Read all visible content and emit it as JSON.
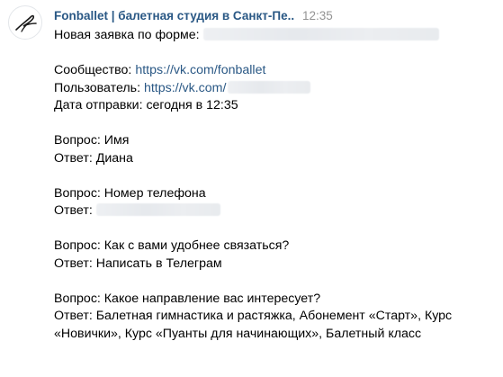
{
  "message": {
    "sender": "Fonballet | балетная студия в Санкт-Пе...",
    "time": "12:35",
    "lines": {
      "form_label": "Новая заявка по форме:",
      "community_label": "Сообщество:",
      "community_link": "https://vk.com/fonballet",
      "user_label": "Пользователь:",
      "user_link": "https://vk.com/",
      "sent_date": "Дата отправки: сегодня в 12:35",
      "q1": "Вопрос: Имя",
      "a1": "Ответ: Диана",
      "q2": "Вопрос: Номер телефона",
      "a2_label": "Ответ:",
      "q3": "Вопрос: Как с вами удобнее связаться?",
      "a3": "Ответ: Написать в Телеграм",
      "q4": "Вопрос: Какое направление вас интересует?",
      "a4": "Ответ: Балетная гимнастика и растяжка, Абонемент «Старт», Курс «Новички», Курс «Пуанты для начинающих», Балетный класс"
    }
  },
  "colors": {
    "link": "#2a5885",
    "time": "#939393",
    "text": "#000000",
    "redaction": "#e8ebee"
  },
  "icons": {
    "avatar": "fonballet-logo-icon"
  }
}
